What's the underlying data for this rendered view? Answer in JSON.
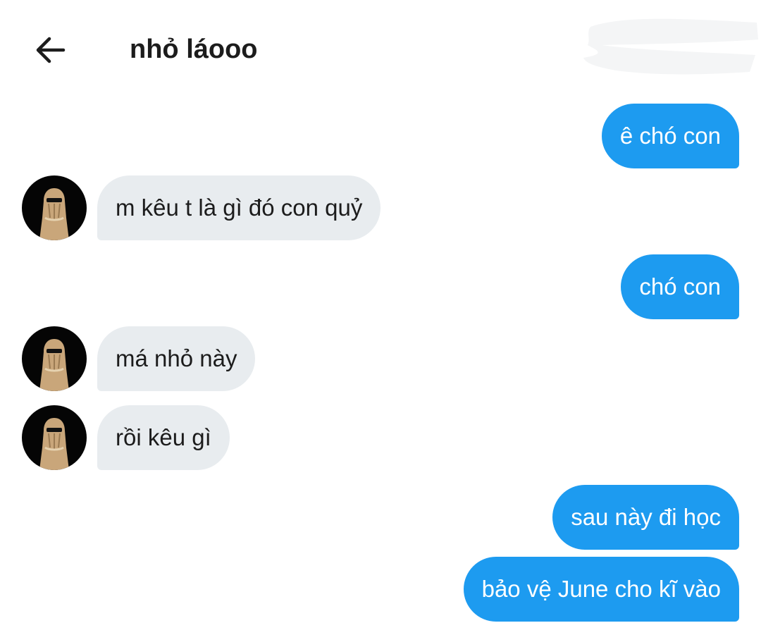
{
  "header": {
    "back_icon": "arrow-left-icon",
    "title": "nhỏ láooo"
  },
  "colors": {
    "outgoing_bubble": "#1d9bf0",
    "incoming_bubble": "#e8ecef",
    "outgoing_text": "#ffffff",
    "incoming_text": "#1c1c1c",
    "avatar_background": "#050505"
  },
  "messages": [
    {
      "direction": "outgoing",
      "text": "ê chó con"
    },
    {
      "direction": "incoming",
      "text": "m kêu t là gì đó con quỷ"
    },
    {
      "direction": "outgoing",
      "text": "chó con"
    },
    {
      "direction": "incoming",
      "text": "má nhỏ này"
    },
    {
      "direction": "incoming",
      "text": "rồi kêu gì"
    },
    {
      "direction": "outgoing",
      "text": "sau này đi học"
    },
    {
      "direction": "outgoing",
      "text": "bảo vệ June cho kĩ vào"
    }
  ]
}
